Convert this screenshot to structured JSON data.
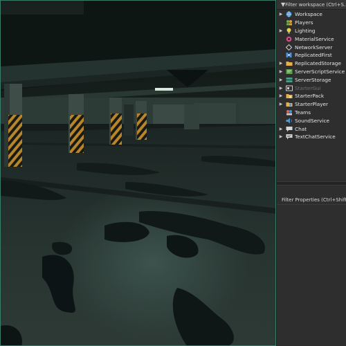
{
  "explorer": {
    "filter_label": "Filter workspace (Ctrl+S...",
    "items": [
      {
        "label": "Workspace",
        "icon": "globe-icon",
        "arrow": "▶",
        "dim": false
      },
      {
        "label": "Players",
        "icon": "players-icon",
        "arrow": "",
        "dim": false
      },
      {
        "label": "Lighting",
        "icon": "lightbulb-icon",
        "arrow": "▶",
        "dim": false
      },
      {
        "label": "MaterialService",
        "icon": "material-icon",
        "arrow": "",
        "dim": false
      },
      {
        "label": "NetworkServer",
        "icon": "network-icon",
        "arrow": "",
        "dim": false
      },
      {
        "label": "ReplicatedFirst",
        "icon": "replicated-first-icon",
        "arrow": "",
        "dim": false
      },
      {
        "label": "ReplicatedStorage",
        "icon": "folder-icon",
        "arrow": "▶",
        "dim": false
      },
      {
        "label": "ServerScriptService",
        "icon": "script-service-icon",
        "arrow": "▶",
        "dim": false
      },
      {
        "label": "ServerStorage",
        "icon": "server-storage-icon",
        "arrow": "▶",
        "dim": false
      },
      {
        "label": "StarterGui",
        "icon": "gui-icon",
        "arrow": "▶",
        "dim": true
      },
      {
        "label": "StarterPack",
        "icon": "starter-pack-icon",
        "arrow": "▶",
        "dim": false
      },
      {
        "label": "StarterPlayer",
        "icon": "starter-player-icon",
        "arrow": "▶",
        "dim": false
      },
      {
        "label": "Teams",
        "icon": "teams-icon",
        "arrow": "",
        "dim": false
      },
      {
        "label": "SoundService",
        "icon": "sound-icon",
        "arrow": "",
        "dim": false
      },
      {
        "label": "Chat",
        "icon": "chat-icon",
        "arrow": "▶",
        "dim": false
      },
      {
        "label": "TextChatService",
        "icon": "text-chat-icon",
        "arrow": "▶",
        "dim": false
      }
    ]
  },
  "properties": {
    "filter_label": "Filter Properties (Ctrl+Shift+P)"
  },
  "colors": {
    "viewport_border": "#3a7d6a",
    "panel_bg": "#2e2e2e",
    "hazard_yellow": "#b8862a"
  }
}
